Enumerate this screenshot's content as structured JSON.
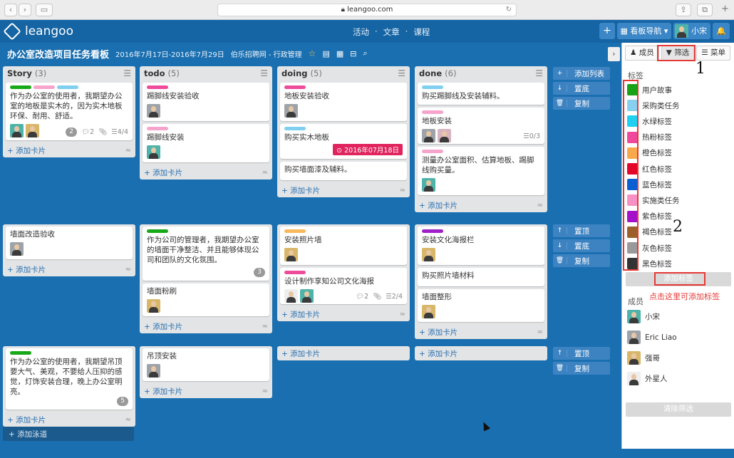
{
  "browser": {
    "url": "leangoo.com",
    "nav_back": "‹",
    "nav_fwd": "›",
    "sidebar": "▭",
    "reload": "↻",
    "share": "⇪",
    "tabs": "⧉",
    "newtab": "+"
  },
  "app": {
    "brand": "leangoo",
    "nav": [
      "活动",
      "·",
      "文章",
      "·",
      "课程"
    ],
    "add": "+",
    "board_nav": "看板导航 ▾",
    "user": "小宋",
    "bell": "🔔"
  },
  "board": {
    "title": "办公室改造项目任务看板",
    "dates": "2016年7月17日-2016年7月29日",
    "team": "伯乐招聘网 - 行政管理",
    "icons": {
      "star": "☆",
      "chart": "▤",
      "table": "▦",
      "minus": "⊟",
      "search": "⌕"
    }
  },
  "colors": {
    "green": "#18a918",
    "pink": "#ee4b9a",
    "skyblue": "#7fcff0",
    "orange": "#f8b85c",
    "purple": "#a020c8",
    "lightpink": "#f7a4cc"
  },
  "columns": [
    {
      "name": "Story",
      "count": "(3)"
    },
    {
      "name": "todo",
      "count": "(5)"
    },
    {
      "name": "doing",
      "count": "(5)"
    },
    {
      "name": "done",
      "count": "(6)"
    }
  ],
  "texts": {
    "add_card": "+ 添加卡片",
    "collapse": "≈",
    "menu": "☰",
    "add_lane": "+ 添加泳道",
    "add_list": "添加列表",
    "bottom": "置底",
    "top": "置顶",
    "copy": "复制"
  },
  "cards": {
    "s1": "作为办公室的使用者，我期望办公室的地板是实木的，因为实木地板环保、耐用、舒适。",
    "s1_badges": {
      "bubble": "2",
      "comment": "2",
      "attach": "",
      "check": "4/4"
    },
    "t1": "踢脚线安装验收",
    "t2": "踢脚线安装",
    "d1": "地板安装验收",
    "d2": "购买实木地板",
    "d2_due": "⊙ 2016年07月18日",
    "d3": "购买墙面漆及辅料。",
    "n1": "购买踢脚线及安装辅料。",
    "n2": "地板安装",
    "n2_check": "0/3",
    "n3": "测量办公室面积、估算地板、踢脚线购买量。",
    "s2": "墙面改造验收",
    "t3": "作为公司的管理者，我期望办公室的墙面干净整洁、并且能够体现公司和团队的文化氛围。",
    "t3_bubble": "3",
    "t4": "墙面粉刷",
    "d4": "安装照片墙",
    "d5": "设计制作享知公司文化海报",
    "d5_badges": {
      "comment": "2",
      "check": "2/4"
    },
    "n4": "安装文化海报栏",
    "n5": "购买照片墙材料",
    "n6": "墙面整形",
    "s3": "作为办公室的使用者，我期望吊顶要大气、美观，不要给人压抑的感觉，灯饰安装合理，晚上办公室明亮。",
    "s3_bubble": "5",
    "t5": "吊顶安装"
  },
  "panel": {
    "tabs": [
      "成员",
      "筛选",
      "菜单"
    ],
    "tab_icons": [
      "♟",
      "▼",
      "☰"
    ],
    "tags_title": "标签",
    "tags": [
      {
        "name": "用户故事",
        "color": "#17a217"
      },
      {
        "name": "采购类任务",
        "color": "#87d0ef"
      },
      {
        "name": "水绿标签",
        "color": "#1fd0f0"
      },
      {
        "name": "热粉标签",
        "color": "#f0489a"
      },
      {
        "name": "橙色标签",
        "color": "#f9a94b"
      },
      {
        "name": "红色标签",
        "color": "#e3052a"
      },
      {
        "name": "蓝色标签",
        "color": "#0b5fd2"
      },
      {
        "name": "实施类任务",
        "color": "#f791c4"
      },
      {
        "name": "紫色标签",
        "color": "#a511c9"
      },
      {
        "name": "褐色标签",
        "color": "#9c5f2a"
      },
      {
        "name": "灰色标签",
        "color": "#9a9a9a"
      },
      {
        "name": "黑色标签",
        "color": "#333333"
      }
    ],
    "add_tag": "添加标签",
    "note": "点击这里可添加标签",
    "members_title": "成员",
    "members": [
      "小宋",
      "Eric Liao",
      "强哥",
      "外星人"
    ],
    "clear": "清除筛选",
    "annot1": "1",
    "annot2": "2"
  }
}
